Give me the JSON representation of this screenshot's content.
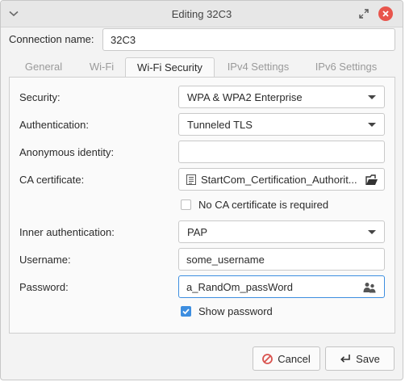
{
  "window": {
    "title": "Editing 32C3"
  },
  "connection": {
    "label": "Connection name:",
    "value": "32C3"
  },
  "tabs": [
    {
      "label": "General",
      "active": false
    },
    {
      "label": "Wi-Fi",
      "active": false
    },
    {
      "label": "Wi-Fi Security",
      "active": true
    },
    {
      "label": "IPv4 Settings",
      "active": false
    },
    {
      "label": "IPv6 Settings",
      "active": false
    }
  ],
  "security": {
    "label": "Security:",
    "value": "WPA & WPA2 Enterprise"
  },
  "authentication": {
    "label": "Authentication:",
    "value": "Tunneled TLS"
  },
  "anonymous_identity": {
    "label": "Anonymous identity:",
    "value": ""
  },
  "ca_certificate": {
    "label": "CA certificate:",
    "value": "StartCom_Certification_Authorit..."
  },
  "no_ca_required": {
    "label": "No CA certificate is required",
    "checked": false
  },
  "inner_authentication": {
    "label": "Inner authentication:",
    "value": "PAP"
  },
  "username": {
    "label": "Username:",
    "value": "some_username"
  },
  "password": {
    "label": "Password:",
    "value": "a_RandOm_passWord"
  },
  "show_password": {
    "label": "Show password",
    "checked": true
  },
  "buttons": {
    "cancel": "Cancel",
    "save": "Save"
  },
  "colors": {
    "accent": "#3d8ee0",
    "close": "#e8554c",
    "cancel_icon": "#d9534f"
  },
  "icons": {
    "window_menu": "chevron-down-icon",
    "restore": "restore-icon",
    "close": "close-icon",
    "certificate": "document-icon",
    "open_file": "open-file-icon",
    "password_options": "users-icon",
    "cancel": "cancel-icon",
    "save": "enter-arrow-icon"
  }
}
